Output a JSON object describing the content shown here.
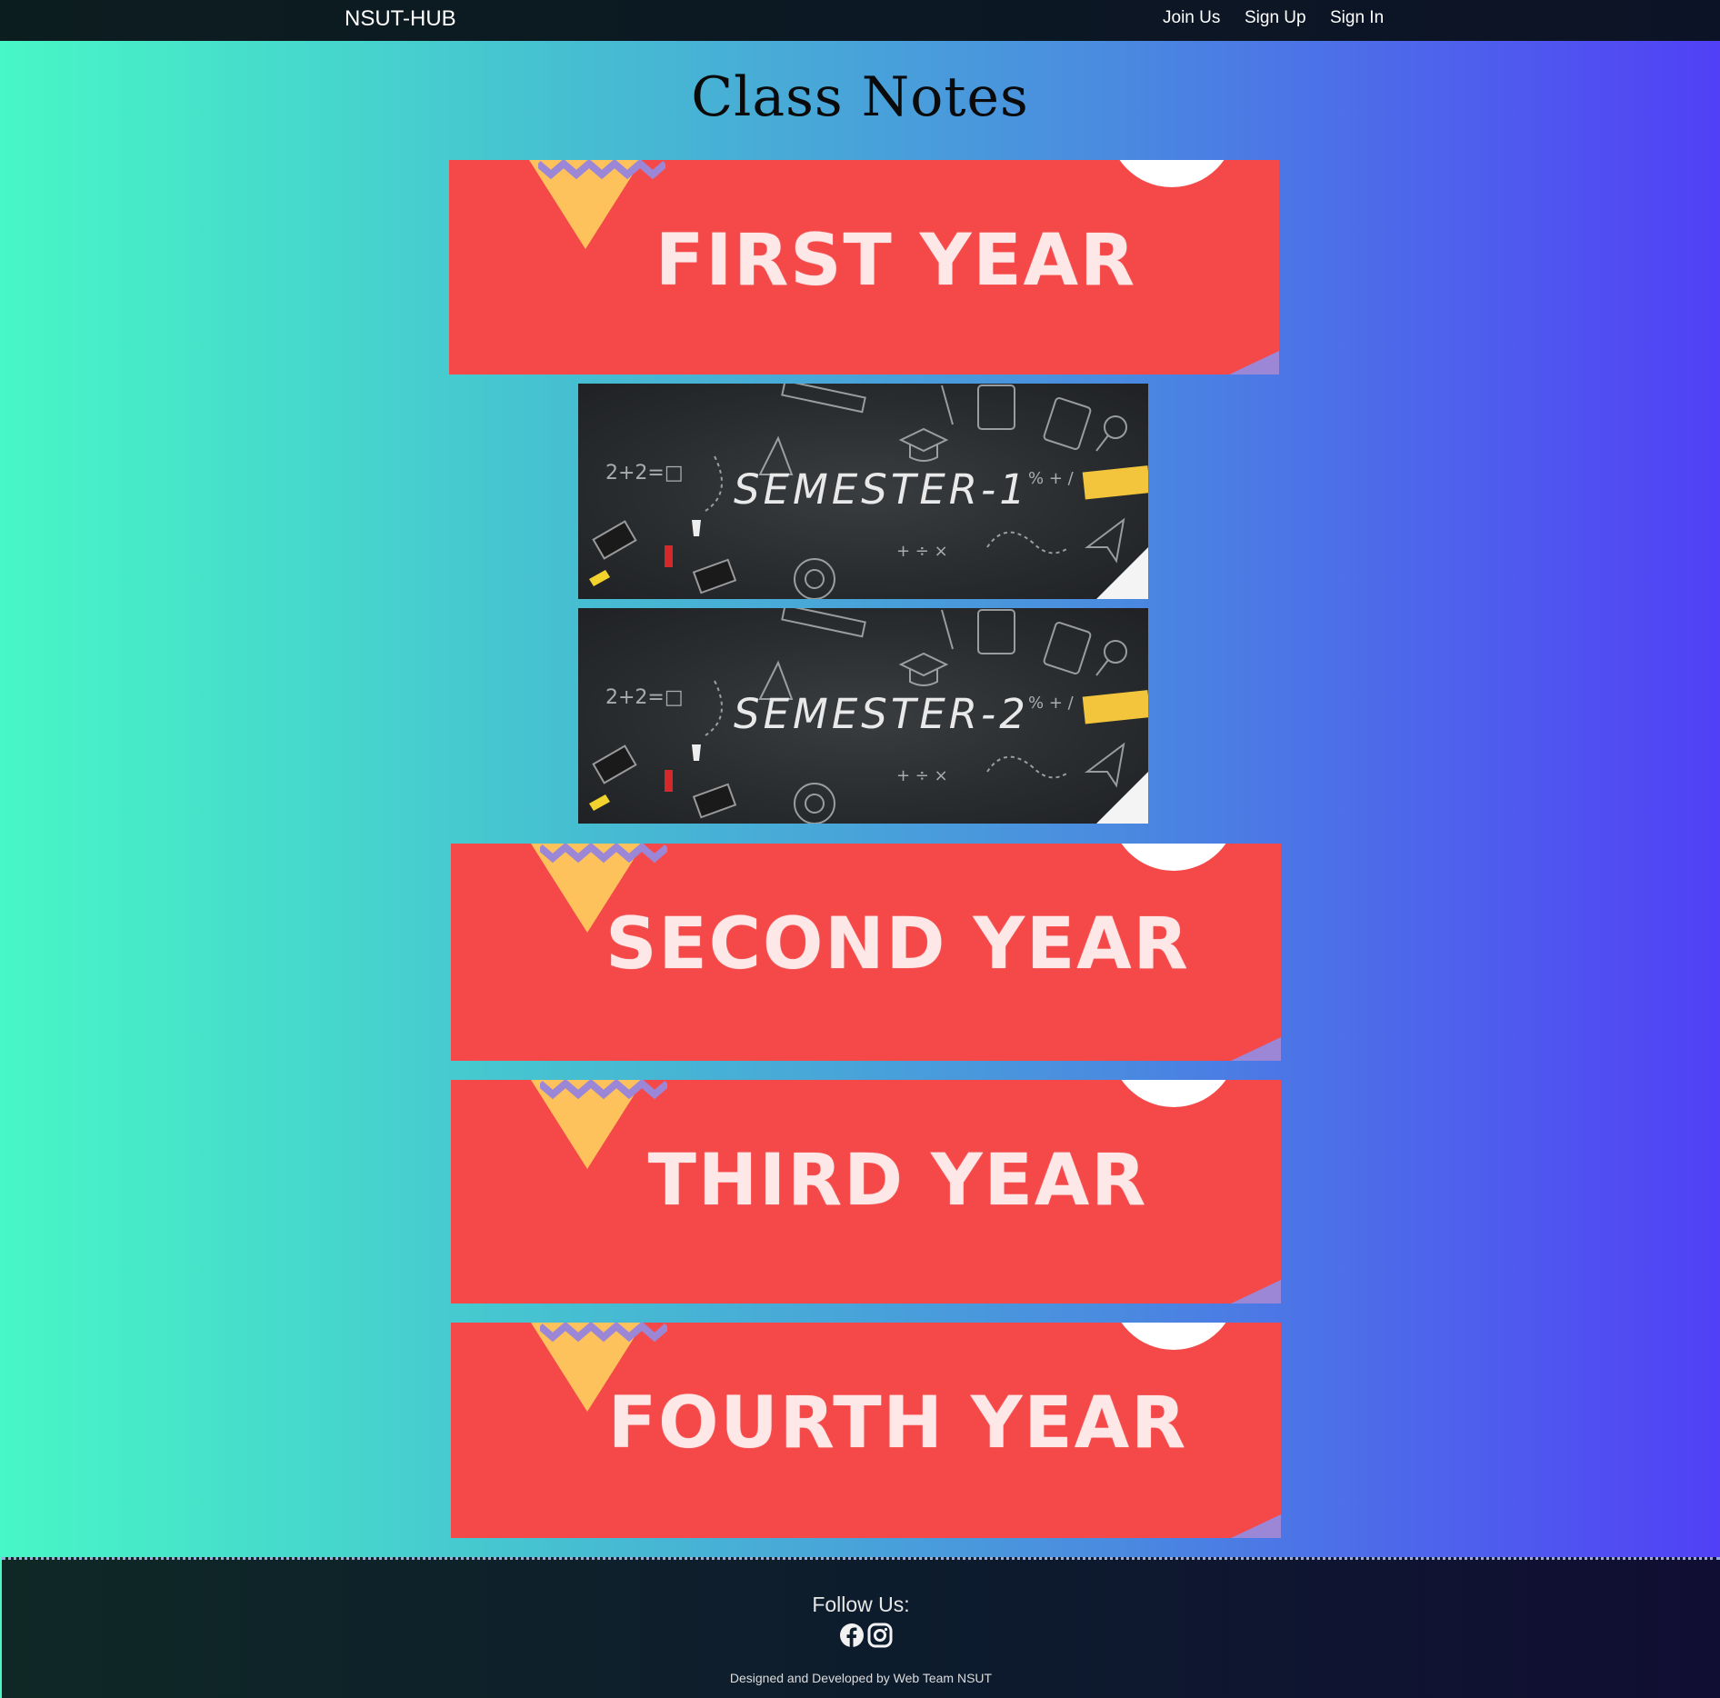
{
  "navbar": {
    "brand": "NSUT-HUB",
    "links": [
      "Join Us",
      "Sign Up",
      "Sign In"
    ]
  },
  "page_title": "Class Notes",
  "years": [
    {
      "label": "FIRST YEAR"
    },
    {
      "label": "SECOND YEAR"
    },
    {
      "label": "THIRD YEAR"
    },
    {
      "label": "FOURTH YEAR"
    }
  ],
  "semesters": [
    {
      "label": "SEMESTER-1",
      "doodle": "2+2=□"
    },
    {
      "label": "SEMESTER-2",
      "doodle": "2+2=□"
    }
  ],
  "footer": {
    "follow_label": "Follow Us:",
    "icons": [
      "facebook-icon",
      "instagram-icon"
    ],
    "credits": "Designed and Developed by Web Team NSUT"
  },
  "colors": {
    "banner_red": "#f54848",
    "banner_yellow": "#fdc25c",
    "banner_purple": "#9b87d6",
    "gradient_start": "#47f7c6",
    "gradient_end": "#5140f6"
  }
}
